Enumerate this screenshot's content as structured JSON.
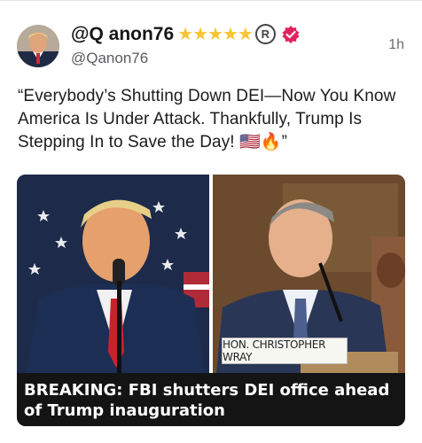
{
  "post": {
    "display_name": "@Q anon76",
    "stars": "★★★★★",
    "registered_mark": "R",
    "handle": "@Qanon76",
    "time": "1h",
    "text": "“Everybody’s Shutting Down DEI—Now You Know America Is Under Attack. Thankfully, Trump Is Stepping In to Save the Day! 🇺🇸🔥”"
  },
  "media": {
    "nameplate": "HON. CHRISTOPHER WRAY",
    "caption": "BREAKING: FBI shutters DEI office ahead of Trump inauguration"
  },
  "icons": {
    "verified": "verified-badge-icon",
    "avatar": "avatar"
  },
  "colors": {
    "star": "#f6c531",
    "verified": "#e0245e"
  }
}
